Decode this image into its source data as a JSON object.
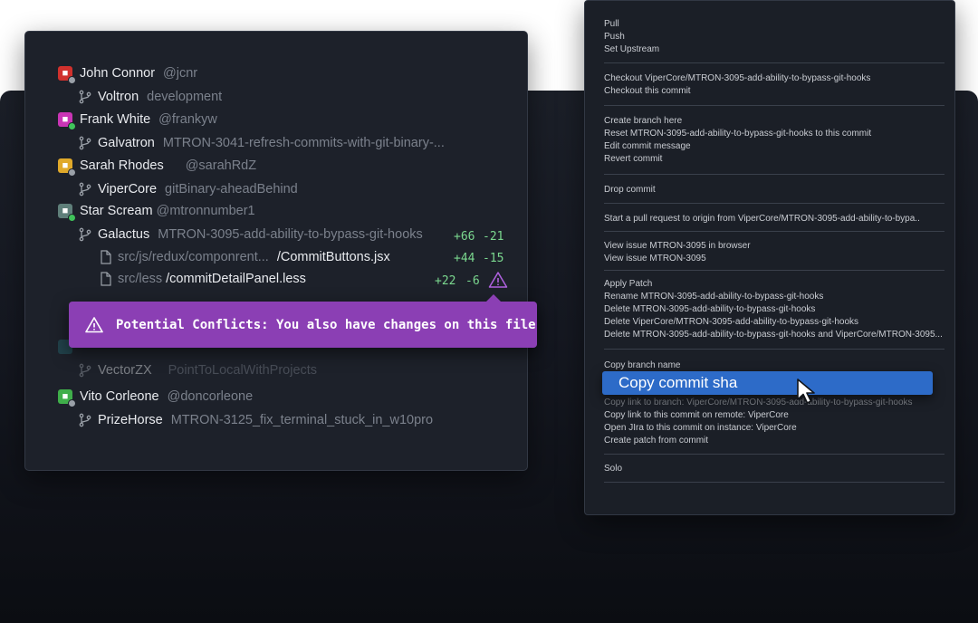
{
  "authors": [
    {
      "name": "John Connor",
      "handle": "@jcnr",
      "avatar_color": "#d0312d",
      "status_color": "#9aa0a8",
      "branch": "Voltron",
      "branch_desc": "development"
    },
    {
      "name": "Frank White",
      "handle": "@frankyw",
      "avatar_color": "#c935b5",
      "status_color": "#3fc35a",
      "branch": "Galvatron",
      "branch_desc": "MTRON-3041-refresh-commits-with-git-binary-..."
    },
    {
      "name": "Sarah Rhodes",
      "handle": "@sarahRdZ",
      "avatar_color": "#e0a92a",
      "status_color": "#9aa0a8",
      "branch": "ViperCore",
      "branch_desc": "gitBinary-aheadBehind"
    },
    {
      "name": "Star Scream",
      "handle": "@mtronnumber1",
      "avatar_color": "#5f7f7a",
      "status_color": "#3fc35a",
      "branch": "Galactus",
      "branch_desc": "MTRON-3095-add-ability-to-bypass-git-hooks",
      "added": "+66",
      "removed": "-21"
    }
  ],
  "files": [
    {
      "path": "src/js/redux/componrent...",
      "name": "/CommitButtons.jsx",
      "added": "+44",
      "removed": "-15"
    },
    {
      "path": "src/less",
      "name": "/commitDetailPanel.less",
      "added": "+22",
      "removed": "-6"
    }
  ],
  "tooltip": {
    "text": "Potential Conflicts: You also have changes on this file"
  },
  "authors_lower": [
    {
      "branch": "VectorZX",
      "branch_desc": "PointToLocalWithProjects"
    },
    {
      "name": "Vito Corleone",
      "handle": "@doncorleone",
      "avatar_color": "#3fae4a",
      "status_color": "#9aa0a8",
      "branch": "PrizeHorse",
      "branch_desc": "MTRON-3125_fix_terminal_stuck_in_w10pro"
    }
  ],
  "context_menu": {
    "groups": [
      [
        "Pull",
        "Push",
        "Set Upstream"
      ],
      [
        "Checkout ViperCore/MTRON-3095-add-ability-to-bypass-git-hooks",
        "Checkout this commit"
      ],
      [
        "Create branch here",
        "Reset MTRON-3095-add-ability-to-bypass-git-hooks to this commit",
        "Edit commit message",
        "Revert commit"
      ],
      [
        "Drop commit"
      ],
      [
        "Start a pull request to origin from ViperCore/MTRON-3095-add-ability-to-bypa.."
      ],
      [
        "View issue MTRON-3095 in browser",
        "View issue MTRON-3095"
      ],
      [
        "Apply Patch",
        "Rename MTRON-3095-add-ability-to-bypass-git-hooks",
        "Delete MTRON-3095-add-ability-to-bypass-git-hooks",
        "Delete ViperCore/MTRON-3095-add-ability-to-bypass-git-hooks",
        "Delete MTRON-3095-add-ability-to-bypass-git-hooks and ViperCore/MTRON-3095..."
      ],
      [
        "Copy branch name",
        "Copy commit sha",
        "Copy link to branch:  ViperCore/MTRON-3095-add-ability-to-bypass-git-hooks",
        "Copy link to this commit on remote:  ViperCore",
        "Open JIra to this commit on instance:  ViperCore",
        "Create patch from commit"
      ],
      [
        "Solo"
      ]
    ],
    "highlighted": "Copy commit sha"
  }
}
